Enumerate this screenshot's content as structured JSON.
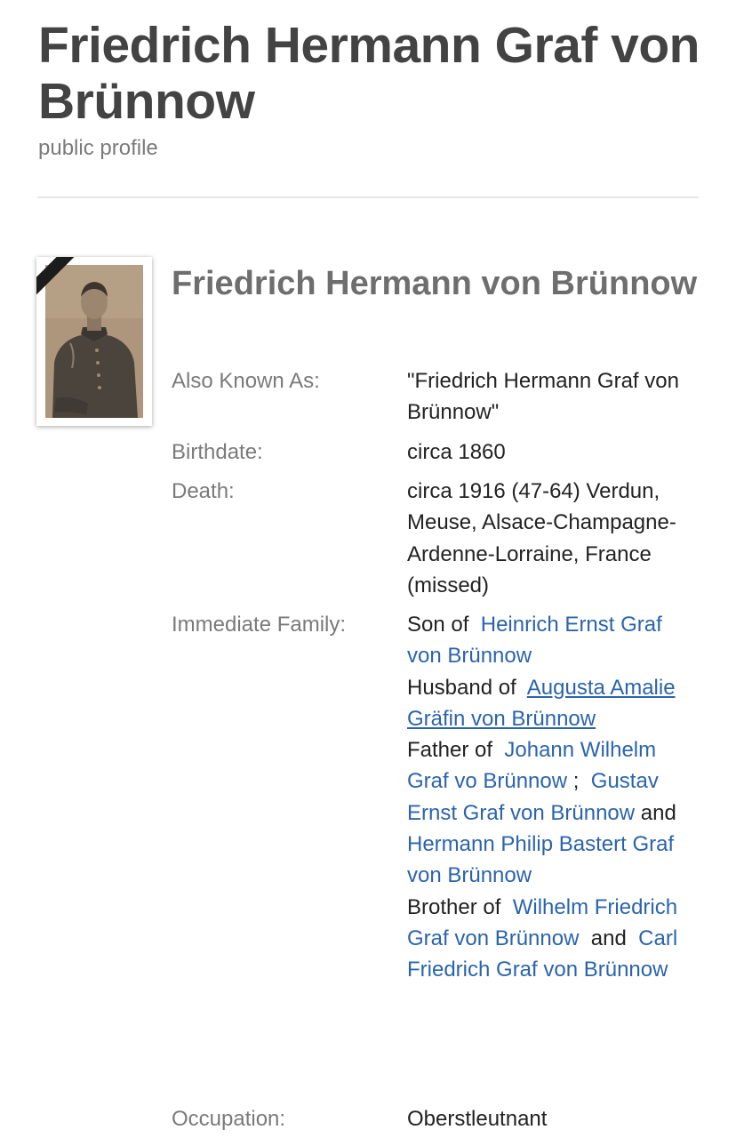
{
  "header": {
    "title": "Friedrich Hermann Graf von Brünnow",
    "subtitle": "public profile"
  },
  "profile": {
    "name": "Friedrich Hermann von Brünnow",
    "fields": {
      "aka": {
        "label": "Also Known As:",
        "value": "\"Friedrich Hermann Graf von Brünnow\""
      },
      "birth": {
        "label": "Birthdate:",
        "value": "circa 1860"
      },
      "death": {
        "label": "Death:",
        "value": "circa 1916 (47-64) Verdun, Meuse, Alsace-Champagne-Ardenne-Lorraine, France (missed)"
      },
      "family": {
        "label": "Immediate Family:",
        "son_of": "Son of",
        "father_name": "Heinrich Ernst Graf von Brünnow",
        "husband_of": "Husband of",
        "wife_name": "Augusta Amalie Gräfin von Brünnow",
        "father_of": "Father of",
        "child1": "Johann Wilhelm Graf vo Brünnow",
        "sep": ";",
        "child2": "Gustav Ernst Graf von Brünnow",
        "and": "and",
        "child3": "Hermann Philip Bastert Graf von Brünnow",
        "brother_of": "Brother of",
        "sibling1": "Wilhelm Friedrich Graf von Brünnow",
        "and2": "and",
        "sibling2": "Carl Friedrich Graf von Brünnow"
      },
      "occupation": {
        "label": "Occupation:",
        "value": "Oberstleutnant"
      }
    }
  },
  "colors": {
    "link": "#2a64ad",
    "title": "#434343",
    "label": "#7a7a7a"
  }
}
